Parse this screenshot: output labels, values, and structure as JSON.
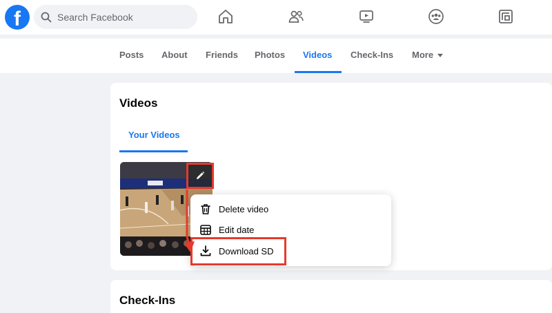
{
  "topbar": {
    "logo_letter": "f",
    "search_placeholder": "Search Facebook",
    "nav_icons": [
      "home-icon",
      "friends-icon",
      "watch-icon",
      "groups-icon",
      "gaming-icon"
    ]
  },
  "profile_tabs": {
    "items": [
      "Posts",
      "About",
      "Friends",
      "Photos",
      "Videos",
      "Check-Ins"
    ],
    "more_label": "More",
    "active": "Videos"
  },
  "videos_section": {
    "title": "Videos",
    "subtab": "Your Videos"
  },
  "context_menu": {
    "items": [
      {
        "label": "Delete video",
        "icon": "trash-icon"
      },
      {
        "label": "Edit date",
        "icon": "calendar-icon"
      },
      {
        "label": "Download SD",
        "icon": "download-icon"
      }
    ]
  },
  "checkins_section": {
    "title": "Check-Ins"
  },
  "colors": {
    "brand": "#1877f2",
    "highlight": "#e53a2c",
    "background": "#f0f2f5"
  }
}
